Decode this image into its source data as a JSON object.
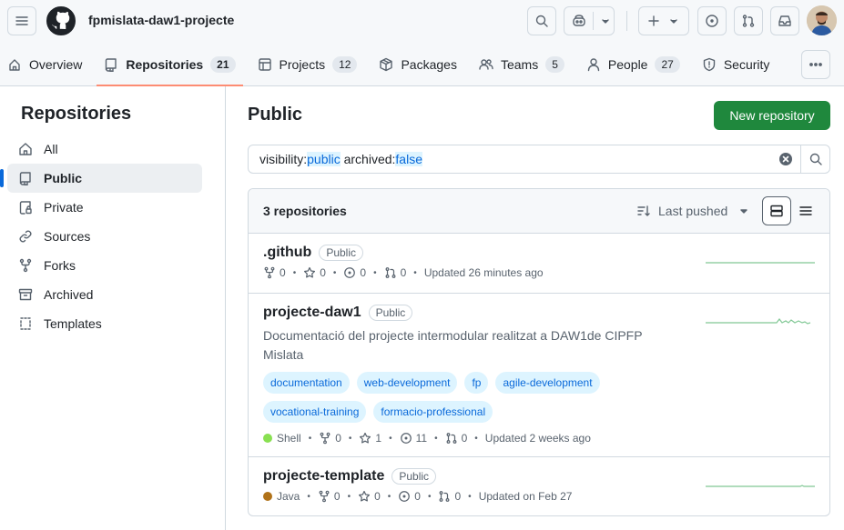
{
  "header": {
    "org_name": "fpmislata-daw1-projecte"
  },
  "tabs": [
    {
      "label": "Overview",
      "icon": "book-open-icon"
    },
    {
      "label": "Repositories",
      "count": "21",
      "icon": "repo-icon",
      "active": true
    },
    {
      "label": "Projects",
      "count": "12",
      "icon": "table-icon"
    },
    {
      "label": "Packages",
      "icon": "package-icon"
    },
    {
      "label": "Teams",
      "count": "5",
      "icon": "people-icon"
    },
    {
      "label": "People",
      "count": "27",
      "icon": "person-icon"
    },
    {
      "label": "Security",
      "icon": "shield-icon"
    }
  ],
  "sidebar": {
    "title": "Repositories",
    "items": [
      {
        "label": "All",
        "icon": "home-icon"
      },
      {
        "label": "Public",
        "icon": "repo-icon",
        "active": true
      },
      {
        "label": "Private",
        "icon": "lock-icon"
      },
      {
        "label": "Sources",
        "icon": "link-icon"
      },
      {
        "label": "Forks",
        "icon": "fork-icon"
      },
      {
        "label": "Archived",
        "icon": "archive-icon"
      },
      {
        "label": "Templates",
        "icon": "template-icon"
      }
    ]
  },
  "main": {
    "title": "Public",
    "new_repo_label": "New repository",
    "search": {
      "k1": "visibility:",
      "v1": "public",
      "k2": " archived:",
      "v2": "false"
    },
    "list_count": "3 repositories",
    "sort_label": "Last pushed"
  },
  "repos": [
    {
      "name": ".github",
      "visibility": "Public",
      "forks": "0",
      "stars": "0",
      "issues": "0",
      "prs": "0",
      "updated": "Updated 26 minutes ago"
    },
    {
      "name": "projecte-daw1",
      "visibility": "Public",
      "description": "Documentació del projecte intermodular realitzat a DAW1de CIPFP Mislata",
      "topics": [
        "documentation",
        "web-development",
        "fp",
        "agile-development",
        "vocational-training",
        "formacio-professional"
      ],
      "language": "Shell",
      "language_color": "#89e051",
      "forks": "0",
      "stars": "1",
      "issues": "11",
      "prs": "0",
      "updated": "Updated 2 weeks ago"
    },
    {
      "name": "projecte-template",
      "visibility": "Public",
      "language": "Java",
      "language_color": "#b07219",
      "forks": "0",
      "stars": "0",
      "issues": "0",
      "prs": "0",
      "updated": "Updated on Feb 27"
    }
  ],
  "colors": {
    "accent": "#0969da",
    "primary_button": "#1f883d",
    "tab_underline": "#fd8c73",
    "sparkline": "#2da44e"
  }
}
